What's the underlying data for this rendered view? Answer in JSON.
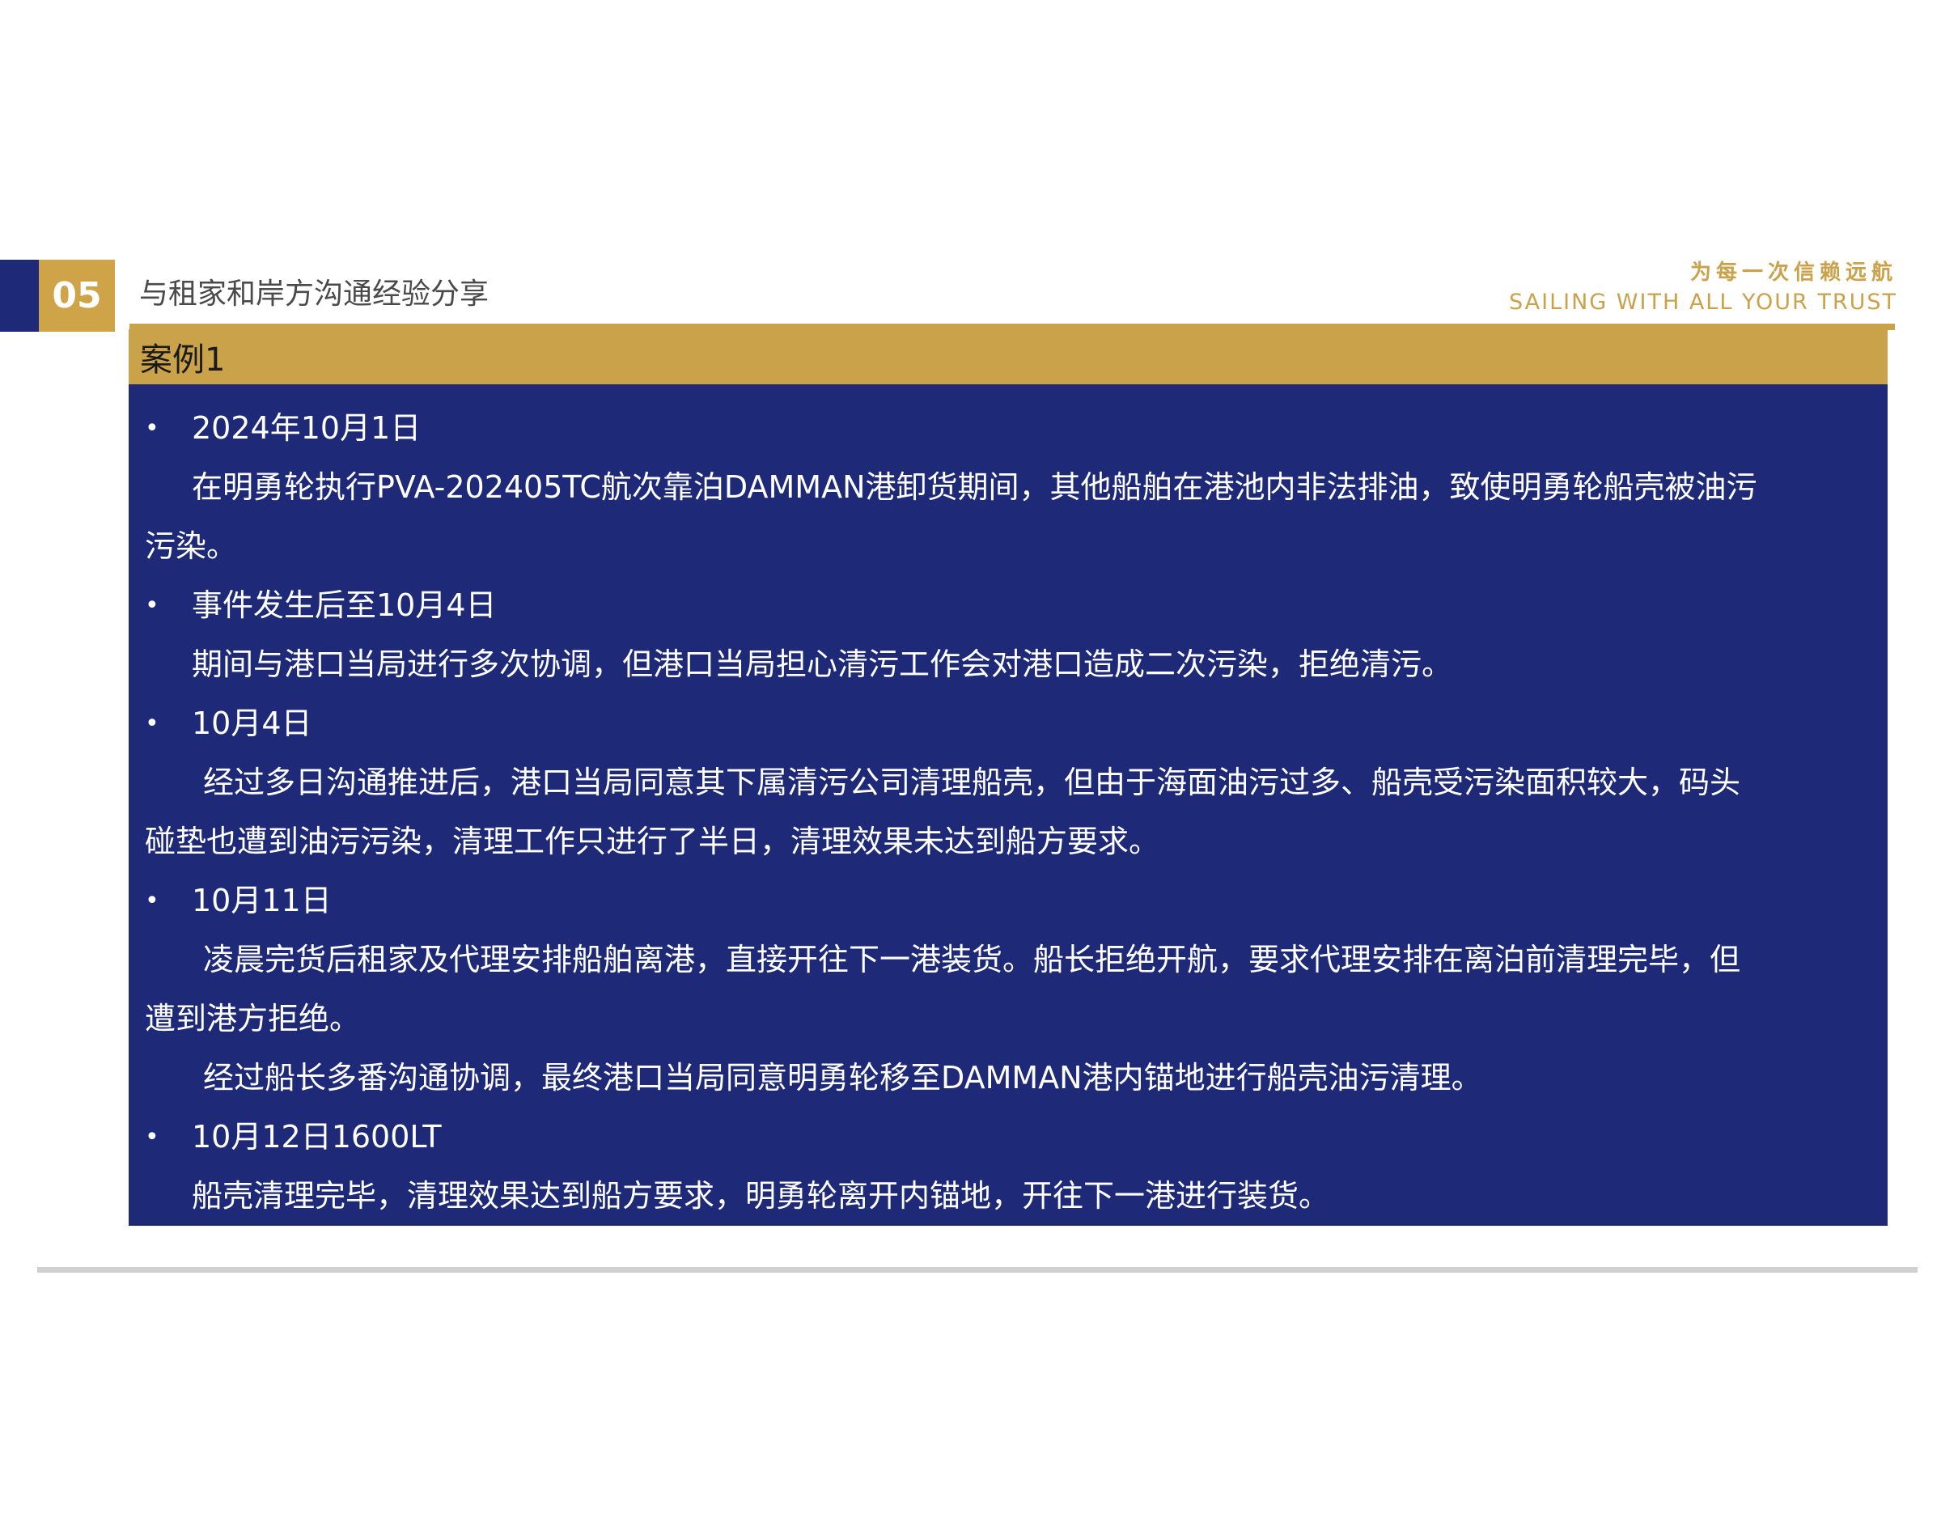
{
  "section": {
    "number": "05",
    "title": "与租家和岸方沟通经验分享"
  },
  "slogan": {
    "cn": "为每一次信赖远航",
    "en": "SAILING WITH ALL YOUR TRUST"
  },
  "case": {
    "title": "案例1"
  },
  "content": {
    "bullet_symbol": "•",
    "b1_date": "2024年10月1日",
    "b1_line1": "在明勇轮执行PVA-202405TC航次靠泊DAMMAN港卸货期间，其他船舶在港池内非法排油，致使明勇轮船壳被油污",
    "b1_line2": "污染。",
    "b2_date": "事件发生后至10月4日",
    "b2_line1": "期间与港口当局进行多次协调，但港口当局担心清污工作会对港口造成二次污染，拒绝清污。",
    "b3_date": "10月4日",
    "b3_line1": "经过多日沟通推进后，港口当局同意其下属清污公司清理船壳，但由于海面油污过多、船壳受污染面积较大，码头",
    "b3_line2": "碰垫也遭到油污污染，清理工作只进行了半日，清理效果未达到船方要求。",
    "b4_date": "10月11日",
    "b4_line1": "凌晨完货后租家及代理安排船舶离港，直接开往下一港装货。船长拒绝开航，要求代理安排在离泊前清理完毕，但",
    "b4_line2": "遭到港方拒绝。",
    "b4_line3": "经过船长多番沟通协调，最终港口当局同意明勇轮移至DAMMAN港内锚地进行船壳油污清理。",
    "b5_date": "10月12日1600LT",
    "b5_line1": "船壳清理完毕，清理效果达到船方要求，明勇轮离开内锚地，开往下一港进行装货。"
  }
}
